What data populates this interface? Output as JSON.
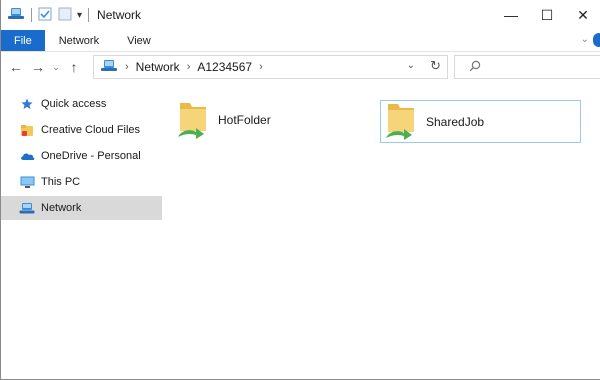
{
  "window": {
    "title": "Network"
  },
  "titlebar": {
    "minimize_glyph": "—",
    "maximize_glyph": "☐",
    "close_glyph": "✕",
    "qa_dropdown_glyph": "▾"
  },
  "ribbon": {
    "tabs": [
      "File",
      "Network",
      "View"
    ],
    "collapse_glyph": "⌄"
  },
  "address": {
    "back_glyph": "←",
    "forward_glyph": "→",
    "recent_glyph": "⌄",
    "up_glyph": "↑",
    "crumbs": [
      "Network",
      "A1234567"
    ],
    "crumb_sep": "›",
    "dropdown_glyph": "⌄",
    "refresh_glyph": "↻"
  },
  "sidebar": {
    "items": [
      {
        "label": "Quick access",
        "icon": "star-icon"
      },
      {
        "label": "Creative Cloud Files",
        "icon": "creative-cloud-folder-icon"
      },
      {
        "label": "OneDrive - Personal",
        "icon": "onedrive-cloud-icon"
      },
      {
        "label": "This PC",
        "icon": "monitor-icon"
      },
      {
        "label": "Network",
        "icon": "network-icon",
        "selected": true
      }
    ]
  },
  "content": {
    "items": [
      {
        "label": "HotFolder",
        "icon": "shared-folder-icon",
        "selected": false
      },
      {
        "label": "SharedJob",
        "icon": "shared-folder-icon",
        "selected": true
      }
    ]
  },
  "colors": {
    "accent": "#1a6ccc",
    "selection_border": "#99c9ef",
    "sidebar_selected": "#d9d9d9",
    "folder_yellow": "#f3c85a",
    "share_green": "#4caf50"
  }
}
